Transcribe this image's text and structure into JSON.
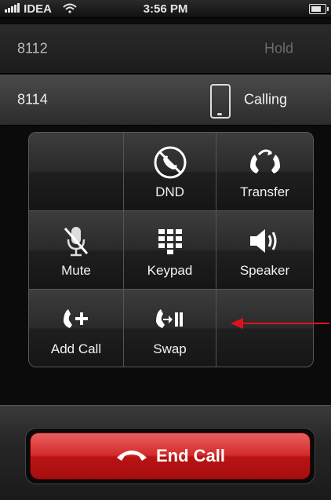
{
  "status_bar": {
    "carrier": "IDEA",
    "time": "3:56 PM",
    "icons": [
      "signal-icon",
      "wifi-icon",
      "battery-icon"
    ]
  },
  "calls": [
    {
      "number": "8112",
      "status": "Hold"
    },
    {
      "number": "8114",
      "status": "Calling",
      "icon": "phone-icon"
    }
  ],
  "buttons": [
    {
      "label": "",
      "icon": ""
    },
    {
      "label": "DND",
      "icon": "dnd-icon"
    },
    {
      "label": "Transfer",
      "icon": "transfer-icon"
    },
    {
      "label": "Mute",
      "icon": "mute-icon"
    },
    {
      "label": "Keypad",
      "icon": "keypad-icon"
    },
    {
      "label": "Speaker",
      "icon": "speaker-icon"
    },
    {
      "label": "Add Call",
      "icon": "add-call-icon"
    },
    {
      "label": "Swap",
      "icon": "swap-icon"
    },
    {
      "label": "",
      "icon": ""
    }
  ],
  "end_call": {
    "label": "End Call",
    "icon": "end-call-icon"
  },
  "colors": {
    "end_call": "#d42a2a",
    "annotation_arrow": "#e0101a"
  }
}
